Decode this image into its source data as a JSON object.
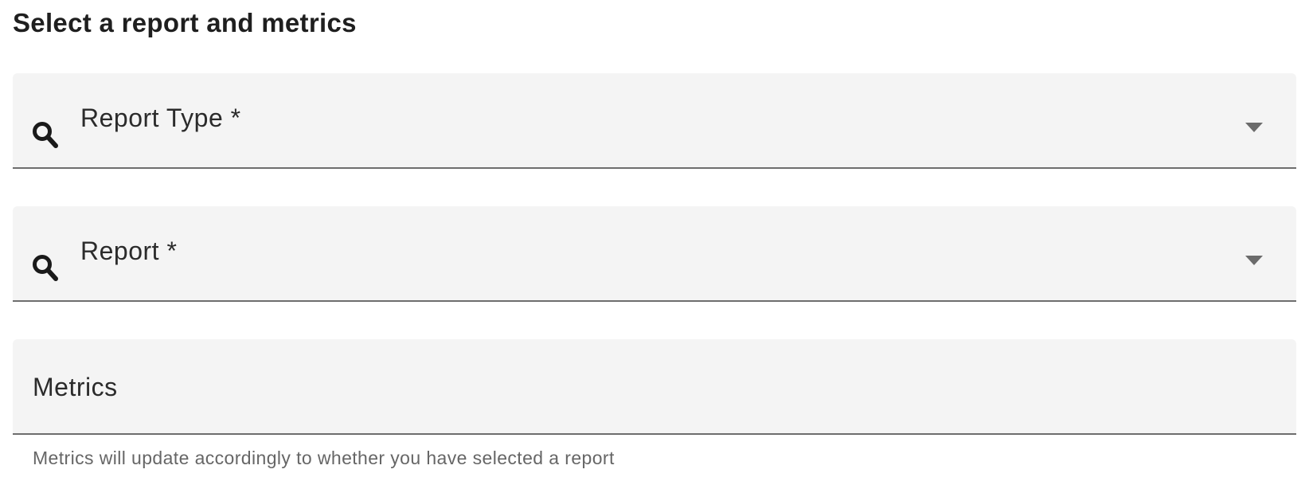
{
  "form": {
    "heading": "Select a report and metrics",
    "report_type": {
      "label": "Report Type *",
      "icon": "search-icon",
      "dropdown_icon": "chevron-down-icon"
    },
    "report": {
      "label": "Report *",
      "icon": "search-icon",
      "dropdown_icon": "chevron-down-icon"
    },
    "metrics": {
      "label": "Metrics",
      "helper_text": "Metrics will update accordingly to whether you have selected a report"
    }
  },
  "colors": {
    "field_background": "#f4f4f4",
    "field_underline": "#6e6e6e",
    "text_primary": "#222222",
    "text_helper": "#666666"
  }
}
